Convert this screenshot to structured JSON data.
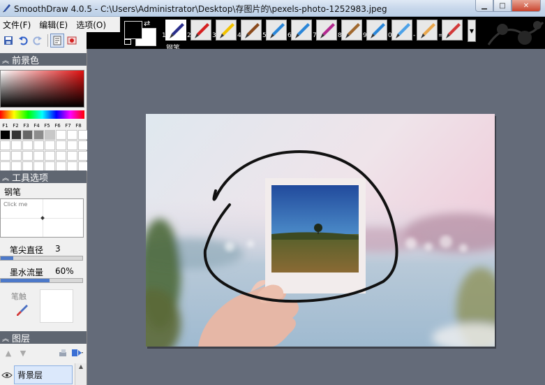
{
  "window": {
    "title": "SmoothDraw 4.0.5 - C:\\Users\\Administrator\\Desktop\\存图片的\\pexels-photo-1252983.jpeg",
    "minimize": "▁",
    "maximize": "□",
    "close": "✕"
  },
  "menu": [
    {
      "label": "文件(F)"
    },
    {
      "label": "编辑(E)"
    },
    {
      "label": "选项(O)"
    }
  ],
  "colors": {
    "foreground": "#000000",
    "background": "#ffffff",
    "accent": "#4d79c9",
    "panel_header": "#5f6671"
  },
  "tools": [
    {
      "num": "1",
      "icon": "pen-icon",
      "color": "#2b2f8c"
    },
    {
      "num": "2",
      "icon": "red-pencil-icon",
      "color": "#d42020"
    },
    {
      "num": "3",
      "icon": "yellow-marker-icon",
      "color": "#f2c200"
    },
    {
      "num": "4",
      "icon": "brush-icon",
      "color": "#8a4a1d"
    },
    {
      "num": "5",
      "icon": "airbrush-icon",
      "color": "#2a86d8"
    },
    {
      "num": "6",
      "icon": "airbrush-2-icon",
      "color": "#2a86d8"
    },
    {
      "num": "7",
      "icon": "pastel-icon",
      "color": "#b22a8f"
    },
    {
      "num": "8",
      "icon": "paint-brush-icon",
      "color": "#a0682e"
    },
    {
      "num": "9",
      "icon": "sparkle-brush-icon",
      "color": "#2a86d8"
    },
    {
      "num": "0",
      "icon": "water-drop-icon",
      "color": "#4da2e8"
    },
    {
      "num": "-",
      "icon": "smudge-finger-icon",
      "color": "#e8a64d"
    },
    {
      "num": "=",
      "icon": "eraser-icon",
      "color": "#d23a3a"
    }
  ],
  "selected_tool_caption": "钢笔",
  "panels": {
    "foreground_color": {
      "title": "前景色"
    },
    "tool_options": {
      "title": "工具选项",
      "brush_name": "钢笔",
      "clickpad_hint": "Click me",
      "tip_size_label": "笔尖直径",
      "tip_size_value": "3",
      "tip_size_fraction": 0.15,
      "ink_flow_label": "墨水流量",
      "ink_flow_value": "60%",
      "ink_flow_fraction": 0.6,
      "tip_label": "笔触"
    },
    "layers": {
      "title": "图层",
      "items": [
        {
          "name": "背景层"
        }
      ]
    }
  },
  "function_keys": [
    "F1",
    "F2",
    "F3",
    "F4",
    "F5",
    "F6",
    "F7",
    "F8"
  ],
  "palette_rows": [
    [
      "#000000",
      "#333333",
      "#666666",
      "#8c8c8c",
      "#c8c8c8",
      "#ffffff",
      "#ffffff",
      "#ffffff"
    ],
    [
      "#ffffff",
      "#ffffff",
      "#ffffff",
      "#ffffff",
      "#ffffff",
      "#ffffff",
      "#ffffff",
      "#ffffff"
    ],
    [
      "#ffffff",
      "#ffffff",
      "#ffffff",
      "#ffffff",
      "#ffffff",
      "#ffffff",
      "#ffffff",
      "#ffffff"
    ],
    [
      "#ffffff",
      "#ffffff",
      "#ffffff",
      "#ffffff",
      "#ffffff",
      "#ffffff",
      "#ffffff",
      "#ffffff"
    ]
  ]
}
